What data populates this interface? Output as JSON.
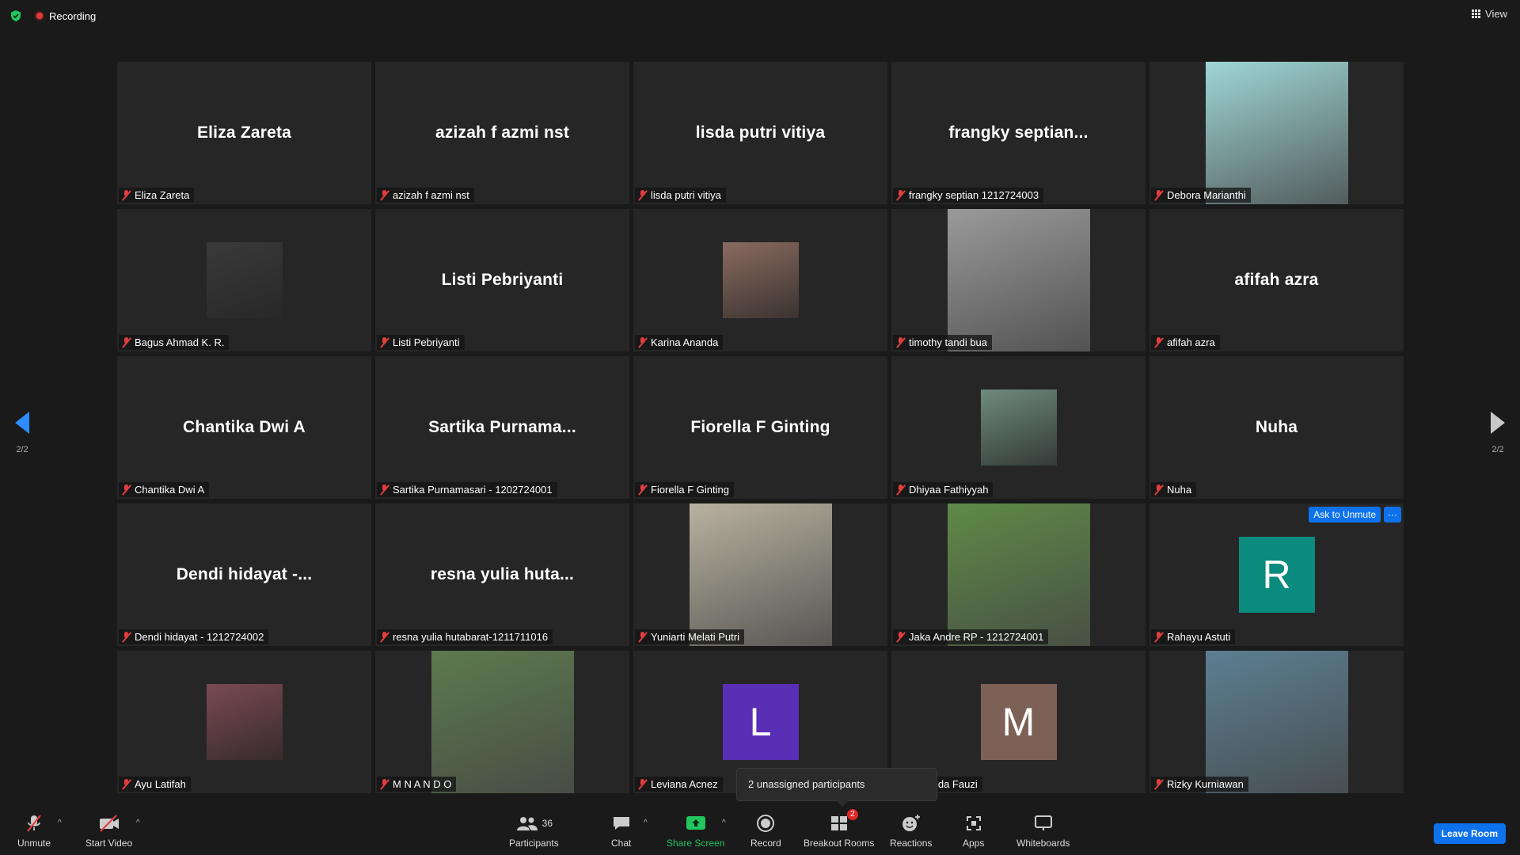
{
  "topbar": {
    "recording_label": "Recording",
    "view_label": "View"
  },
  "pagination": {
    "left": "2/2",
    "right": "2/2"
  },
  "tiles": [
    {
      "display": "Eliza Zareta",
      "name": "Eliza Zareta",
      "type": "text"
    },
    {
      "display": "azizah f azmi nst",
      "name": "azizah f azmi nst",
      "type": "text"
    },
    {
      "display": "lisda putri vitiya",
      "name": "lisda putri vitiya",
      "type": "text"
    },
    {
      "display": "frangky  septian...",
      "name": "frangky septian 1212724003",
      "type": "text"
    },
    {
      "display": "",
      "name": "Debora Marianthi",
      "type": "video",
      "color": "#9fd6d6"
    },
    {
      "display": "",
      "name": "Bagus Ahmad K. R.",
      "type": "photo",
      "color": "#3a3a3a"
    },
    {
      "display": "Listi Pebriyanti",
      "name": "Listi Pebriyanti",
      "type": "text"
    },
    {
      "display": "",
      "name": "Karina Ananda",
      "type": "photo",
      "color": "#8a6b60"
    },
    {
      "display": "",
      "name": "timothy tandi bua",
      "type": "video",
      "color": "#9a9a9a"
    },
    {
      "display": "afifah azra",
      "name": "afifah azra",
      "type": "text"
    },
    {
      "display": "Chantika Dwi A",
      "name": "Chantika Dwi A",
      "type": "text"
    },
    {
      "display": "Sartika  Purnama...",
      "name": "Sartika Purnamasari - 1202724001",
      "type": "text"
    },
    {
      "display": "Fiorella F Ginting",
      "name": "Fiorella F Ginting",
      "type": "text"
    },
    {
      "display": "",
      "name": "Dhiyaa Fathiyyah",
      "type": "photo",
      "color": "#6f8a7e"
    },
    {
      "display": "Nuha",
      "name": "Nuha",
      "type": "text"
    },
    {
      "display": "Dendi  hidayat  -...",
      "name": "Dendi hidayat - 1212724002",
      "type": "text"
    },
    {
      "display": "resna  yulia  huta...",
      "name": "resna yulia hutabarat-1211711016",
      "type": "text"
    },
    {
      "display": "",
      "name": "Yuniarti Melati Putri",
      "type": "video",
      "color": "#b8b2a0"
    },
    {
      "display": "",
      "name": "Jaka Andre RP - 1212724001",
      "type": "video",
      "color": "#5f8a47"
    },
    {
      "display": "R",
      "name": "Rahayu Astuti",
      "type": "avatar",
      "color": "#0b8a7e"
    },
    {
      "display": "",
      "name": "Ayu Latifah",
      "type": "photo",
      "color": "#7a4a52"
    },
    {
      "display": "",
      "name": "M N A N D O",
      "type": "video",
      "color": "#5d7a4e"
    },
    {
      "display": "L",
      "name": "Leviana Acnez",
      "type": "avatar",
      "color": "#5b2fb5"
    },
    {
      "display": "M",
      "name": "Afinanda Fauzi",
      "type": "avatar",
      "color": "#7d6157"
    },
    {
      "display": "",
      "name": "Rizky Kurniawan",
      "type": "video",
      "color": "#5c7f92"
    }
  ],
  "tile_actions": {
    "ask_to_unmute": "Ask to Unmute",
    "more": "···"
  },
  "tooltip": "2 unassigned participants",
  "toolbar": {
    "unmute": "Unmute",
    "start_video": "Start Video",
    "participants": "Participants",
    "participants_count": "36",
    "chat": "Chat",
    "share_screen": "Share Screen",
    "record": "Record",
    "breakout_rooms": "Breakout Rooms",
    "breakout_badge": "2",
    "reactions": "Reactions",
    "apps": "Apps",
    "whiteboards": "Whiteboards",
    "leave": "Leave Room"
  },
  "colors": {
    "accent": "#0e72ed",
    "muted_red": "#e03e3e",
    "share_green": "#23c55e"
  }
}
